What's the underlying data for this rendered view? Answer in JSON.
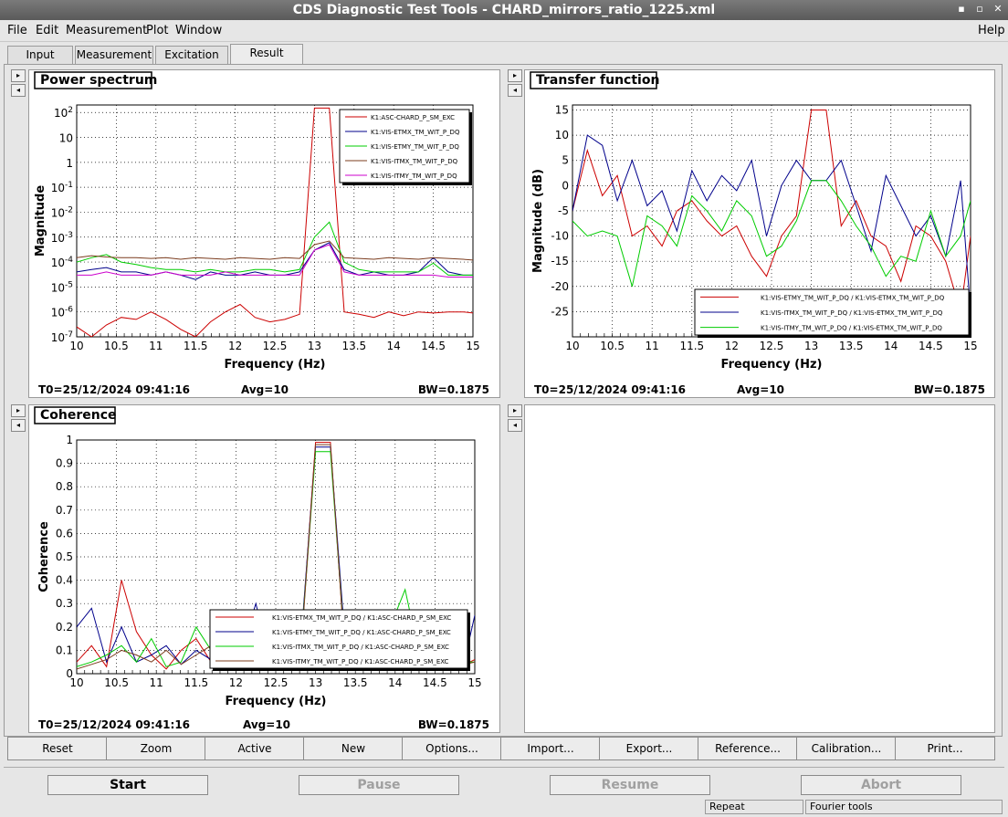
{
  "window": {
    "title": "CDS Diagnostic Test Tools - CHARD_mirrors_ratio_1225.xml",
    "controls": [
      "▪",
      "▫",
      "✕"
    ]
  },
  "menu": [
    {
      "label": "File"
    },
    {
      "label": "Edit"
    },
    {
      "label": "Measurement"
    },
    {
      "label": "Plot"
    },
    {
      "label": "Window"
    },
    {
      "label": "Help"
    }
  ],
  "tabs": [
    {
      "label": "Input"
    },
    {
      "label": "Measurement"
    },
    {
      "label": "Excitation"
    },
    {
      "label": "Result"
    }
  ],
  "pads": {
    "side_arrow_right": "▸",
    "side_arrow_left": "◂"
  },
  "toolbar": [
    "Reset",
    "Zoom",
    "Active",
    "New",
    "Options...",
    "Import...",
    "Export...",
    "Reference...",
    "Calibration...",
    "Print..."
  ],
  "controls": {
    "start": "Start",
    "pause": "Pause",
    "resume": "Resume",
    "abort": "Abort"
  },
  "status": {
    "left": "Repeat",
    "right": "Fourier tools"
  },
  "colors": {
    "red": "#cc0000",
    "blue": "#00008b",
    "green": "#00cc00",
    "brown": "#7b3c1e",
    "magenta": "#cc00cc"
  },
  "chart_data": [
    {
      "type": "line",
      "title": "Power spectrum",
      "xlabel": "Frequency (Hz)",
      "ylabel": "Magnitude",
      "xlim": [
        10,
        15
      ],
      "ylim": [
        1e-07,
        200
      ],
      "yscale": "log",
      "grid": true,
      "xticks": [
        "10",
        "10.5",
        "11",
        "11.5",
        "12",
        "12.5",
        "13",
        "13.5",
        "14",
        "14.5",
        "15"
      ],
      "yticks": [
        {
          "base": "10",
          "exp": "2"
        },
        {
          "base": "10",
          "exp": ""
        },
        {
          "base": "1",
          "exp": ""
        },
        {
          "base": "10",
          "exp": "-1"
        },
        {
          "base": "10",
          "exp": "-2"
        },
        {
          "base": "10",
          "exp": "-3"
        },
        {
          "base": "10",
          "exp": "-4"
        },
        {
          "base": "10",
          "exp": "-5"
        },
        {
          "base": "10",
          "exp": "-6"
        },
        {
          "base": "10",
          "exp": "-7"
        }
      ],
      "footer": {
        "t0": "T0=25/12/2024 09:41:16",
        "avg": "Avg=10",
        "bw": "BW=0.1875"
      },
      "legend_position": "top-right",
      "x": [
        10,
        10.1875,
        10.375,
        10.5625,
        10.75,
        10.9375,
        11.125,
        11.3125,
        11.5,
        11.6875,
        11.875,
        12.0625,
        12.25,
        12.4375,
        12.625,
        12.8125,
        13,
        13.1875,
        13.375,
        13.5625,
        13.75,
        13.9375,
        14.125,
        14.3125,
        14.5,
        14.6875,
        14.875,
        15
      ],
      "series": [
        {
          "name": "K1:ASC-CHARD_P_SM_EXC",
          "color": "red",
          "values": [
            2.5e-07,
            1e-07,
            3e-07,
            6e-07,
            5e-07,
            1e-06,
            5e-07,
            2e-07,
            1e-07,
            4e-07,
            1e-06,
            2e-06,
            6e-07,
            4e-07,
            5e-07,
            8e-07,
            150,
            150,
            1e-06,
            8e-07,
            6e-07,
            1e-06,
            7e-07,
            1e-06,
            9e-07,
            1e-06,
            1e-06,
            9e-07
          ]
        },
        {
          "name": "K1:VIS-ETMX_TM_WIT_P_DQ",
          "color": "blue",
          "values": [
            4e-05,
            5e-05,
            6e-05,
            4e-05,
            4e-05,
            3e-05,
            4e-05,
            3e-05,
            2e-05,
            4e-05,
            3e-05,
            3e-05,
            4e-05,
            3e-05,
            3e-05,
            4e-05,
            0.0003,
            0.0006,
            5e-05,
            3e-05,
            4e-05,
            3e-05,
            3e-05,
            4e-05,
            0.00015,
            4e-05,
            3e-05,
            3e-05
          ]
        },
        {
          "name": "K1:VIS-ETMY_TM_WIT_P_DQ",
          "color": "green",
          "values": [
            0.0001,
            0.00015,
            0.0002,
            0.0001,
            8e-05,
            6e-05,
            5e-05,
            5e-05,
            4e-05,
            5e-05,
            4e-05,
            4e-05,
            5e-05,
            5e-05,
            4e-05,
            5e-05,
            0.001,
            0.004,
            0.0001,
            5e-05,
            4e-05,
            4e-05,
            4e-05,
            4e-05,
            9e-05,
            3e-05,
            3e-05,
            3e-05
          ]
        },
        {
          "name": "K1:VIS-ITMX_TM_WIT_P_DQ",
          "color": "brown",
          "values": [
            0.00015,
            0.00018,
            0.00016,
            0.00015,
            0.00015,
            0.00014,
            0.00015,
            0.00013,
            0.00015,
            0.00014,
            0.00013,
            0.00015,
            0.00014,
            0.00013,
            0.00015,
            0.00014,
            0.0005,
            0.0007,
            0.00015,
            0.00014,
            0.00013,
            0.00015,
            0.00014,
            0.00013,
            0.00015,
            0.00014,
            0.00013,
            0.00012
          ]
        },
        {
          "name": "K1:VIS-ITMY_TM_WIT_P_DQ",
          "color": "magenta",
          "values": [
            3e-05,
            3e-05,
            4e-05,
            3e-05,
            3e-05,
            3e-05,
            4e-05,
            3e-05,
            3e-05,
            3e-05,
            4e-05,
            3e-05,
            3e-05,
            3e-05,
            3e-05,
            3e-05,
            0.0003,
            0.0005,
            4e-05,
            3e-05,
            3e-05,
            3e-05,
            3e-05,
            3e-05,
            3e-05,
            2.5e-05,
            2.5e-05,
            2.5e-05
          ]
        }
      ]
    },
    {
      "type": "line",
      "title": "Transfer function",
      "xlabel": "Frequency (Hz)",
      "ylabel": "Magnitude (dB)",
      "xlim": [
        10,
        15
      ],
      "ylim": [
        -30,
        16
      ],
      "yscale": "linear",
      "grid": true,
      "xticks": [
        "10",
        "10.5",
        "11",
        "11.5",
        "12",
        "12.5",
        "13",
        "13.5",
        "14",
        "14.5",
        "15"
      ],
      "yticks": [
        15,
        10,
        5,
        0,
        -5,
        -10,
        -15,
        -20,
        -25
      ],
      "footer": {
        "t0": "T0=25/12/2024 09:41:16",
        "avg": "Avg=10",
        "bw": "BW=0.1875"
      },
      "legend_position": "bottom-right",
      "x": [
        10,
        10.1875,
        10.375,
        10.5625,
        10.75,
        10.9375,
        11.125,
        11.3125,
        11.5,
        11.6875,
        11.875,
        12.0625,
        12.25,
        12.4375,
        12.625,
        12.8125,
        13,
        13.1875,
        13.375,
        13.5625,
        13.75,
        13.9375,
        14.125,
        14.3125,
        14.5,
        14.6875,
        14.875,
        15
      ],
      "series": [
        {
          "name": "K1:VIS-ETMY_TM_WIT_P_DQ / K1:VIS-ETMX_TM_WIT_P_DQ",
          "color": "red",
          "values": [
            -5,
            7,
            -2,
            2,
            -10,
            -8,
            -12,
            -5,
            -3,
            -7,
            -10,
            -8,
            -14,
            -18,
            -10,
            -6,
            15,
            15,
            -8,
            -3,
            -10,
            -12,
            -19,
            -8,
            -10,
            -15,
            -25,
            -10
          ]
        },
        {
          "name": "K1:VIS-ITMX_TM_WIT_P_DQ / K1:VIS-ETMX_TM_WIT_P_DQ",
          "color": "blue",
          "values": [
            -5,
            10,
            8,
            -3,
            5,
            -4,
            -1,
            -9,
            3,
            -3,
            2,
            -1,
            5,
            -10,
            0,
            5,
            1,
            1,
            5,
            -4,
            -13,
            2,
            -4,
            -10,
            -6,
            -14,
            1,
            -25
          ]
        },
        {
          "name": "K1:VIS-ITMY_TM_WIT_P_DQ / K1:VIS-ETMX_TM_WIT_P_DQ",
          "color": "green",
          "values": [
            -7,
            -10,
            -9,
            -10,
            -20,
            -6,
            -8,
            -12,
            -2,
            -5,
            -9,
            -3,
            -6,
            -14,
            -12,
            -7,
            1,
            1,
            -3,
            -8,
            -12,
            -18,
            -14,
            -15,
            -5,
            -14,
            -10,
            -3
          ]
        }
      ]
    },
    {
      "type": "line",
      "title": "Coherence",
      "xlabel": "Frequency (Hz)",
      "ylabel": "Coherence",
      "xlim": [
        10,
        15
      ],
      "ylim": [
        0,
        1
      ],
      "yscale": "linear",
      "grid": true,
      "xticks": [
        "10",
        "10.5",
        "11",
        "11.5",
        "12",
        "12.5",
        "13",
        "13.5",
        "14",
        "14.5",
        "15"
      ],
      "yticks": [
        1,
        0.9,
        0.8,
        0.7,
        0.6,
        0.5,
        0.4,
        0.3,
        0.2,
        0.1,
        0
      ],
      "footer": {
        "t0": "T0=25/12/2024 09:41:16",
        "avg": "Avg=10",
        "bw": "BW=0.1875"
      },
      "legend_position": "bottom-right",
      "x": [
        10,
        10.1875,
        10.375,
        10.5625,
        10.75,
        10.9375,
        11.125,
        11.3125,
        11.5,
        11.6875,
        11.875,
        12.0625,
        12.25,
        12.4375,
        12.625,
        12.8125,
        13,
        13.1875,
        13.375,
        13.5625,
        13.75,
        13.9375,
        14.125,
        14.3125,
        14.5,
        14.6875,
        14.875,
        15
      ],
      "series": [
        {
          "name": "K1:VIS-ETMX_TM_WIT_P_DQ / K1:ASC-CHARD_P_SM_EXC",
          "color": "red",
          "values": [
            0.05,
            0.12,
            0.03,
            0.4,
            0.18,
            0.08,
            0.02,
            0.1,
            0.15,
            0.05,
            0.08,
            0.12,
            0.06,
            0.03,
            0.08,
            0.1,
            0.99,
            0.99,
            0.05,
            0.03,
            0.06,
            0.02,
            0.05,
            0.04,
            0.03,
            0.05,
            0.04,
            0.06
          ]
        },
        {
          "name": "K1:VIS-ETMY_TM_WIT_P_DQ / K1:ASC-CHARD_P_SM_EXC",
          "color": "blue",
          "values": [
            0.2,
            0.28,
            0.05,
            0.2,
            0.05,
            0.08,
            0.12,
            0.04,
            0.1,
            0.06,
            0.12,
            0.09,
            0.3,
            0.05,
            0.1,
            0.12,
            0.97,
            0.97,
            0.12,
            0.06,
            0.1,
            0.05,
            0.07,
            0.05,
            0.08,
            0.05,
            0.06,
            0.25
          ]
        },
        {
          "name": "K1:VIS-ITMX_TM_WIT_P_DQ / K1:ASC-CHARD_P_SM_EXC",
          "color": "green",
          "values": [
            0.03,
            0.05,
            0.08,
            0.12,
            0.05,
            0.15,
            0.03,
            0.05,
            0.2,
            0.1,
            0.12,
            0.1,
            0.15,
            0.08,
            0.12,
            0.1,
            0.95,
            0.95,
            0.08,
            0.06,
            0.15,
            0.2,
            0.36,
            0.06,
            0.08,
            0.05,
            0.05,
            0.05
          ]
        },
        {
          "name": "K1:VIS-ITMY_TM_WIT_P_DQ / K1:ASC-CHARD_P_SM_EXC",
          "color": "brown",
          "values": [
            0.02,
            0.04,
            0.06,
            0.1,
            0.08,
            0.05,
            0.1,
            0.04,
            0.08,
            0.12,
            0.05,
            0.08,
            0.04,
            0.06,
            0.05,
            0.08,
            0.98,
            0.98,
            0.06,
            0.05,
            0.04,
            0.06,
            0.05,
            0.04,
            0.05,
            0.06,
            0.04,
            0.05
          ]
        }
      ]
    }
  ]
}
